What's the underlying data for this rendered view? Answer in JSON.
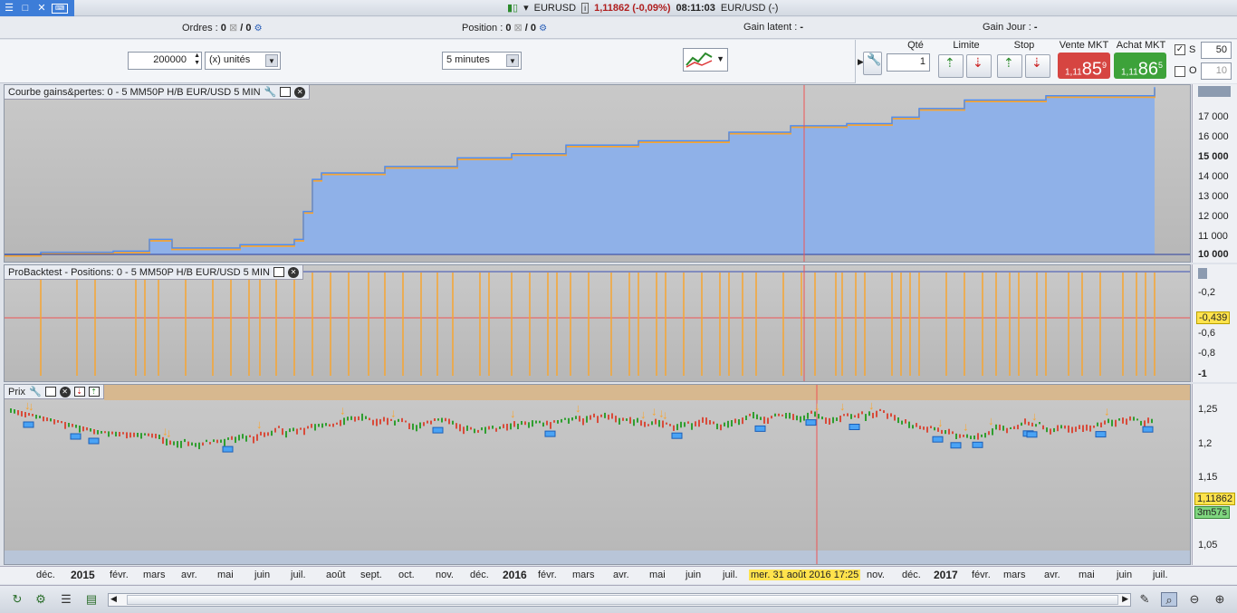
{
  "titlebar": {
    "symbol": "EURUSD",
    "price": "1,11862 (-0,09%)",
    "time": "08:11:03",
    "pair": "EUR/USD (-)"
  },
  "infobar": {
    "orders_label": "Ordres :",
    "orders_a": "0",
    "orders_b": "/ 0",
    "position_label": "Position :",
    "position_a": "0",
    "position_b": "/ 0",
    "gain_latent": "Gain latent :",
    "gain_latent_val": "-",
    "gain_jour": "Gain Jour :",
    "gain_jour_val": "-"
  },
  "toolbar": {
    "quantity": "200000",
    "units": "(x) unités",
    "timeframe": "5 minutes"
  },
  "orderpanel": {
    "qte_label": "Qté",
    "qte_value": "1",
    "limite_label": "Limite",
    "stop_label": "Stop",
    "sell_label": "Vente MKT",
    "sell_prefix": "1,11",
    "sell_big": "85",
    "sell_sup": "9",
    "buy_label": "Achat MKT",
    "buy_prefix": "1,11",
    "buy_big": "86",
    "buy_sup": "5",
    "s_label": "S",
    "s_value": "50",
    "o_label": "O",
    "o_value": "10"
  },
  "panels": {
    "equity_title": "Courbe gains&pertes: 0 - 5 MM50P H/B EUR/USD 5 MIN",
    "positions_title": "ProBacktest - Positions: 0 - 5 MM50P H/B EUR/USD 5 MIN",
    "price_title": "Prix"
  },
  "axes": {
    "equity": [
      "17 000",
      "16 000",
      "15 000",
      "14 000",
      "13 000",
      "12 000",
      "11 000",
      "10 000"
    ],
    "positions": [
      "-0,2",
      "-0,4",
      "-0,6",
      "-0,8",
      "-1"
    ],
    "positions_current": "-0,439",
    "price": [
      "1,25",
      "1,2",
      "1,15",
      "1,1",
      "1,05"
    ],
    "price_current": "1,11862",
    "countdown": "3m57s"
  },
  "dates": [
    "déc.",
    "2015",
    "févr.",
    "mars",
    "avr.",
    "mai",
    "juin",
    "juil.",
    "août",
    "sept.",
    "oct.",
    "nov.",
    "déc.",
    "2016",
    "févr.",
    "mars",
    "avr.",
    "mai",
    "juin",
    "juil.",
    "nov.",
    "déc.",
    "2017",
    "févr.",
    "mars",
    "avr.",
    "mai",
    "juin",
    "juil."
  ],
  "cursor_date": "mer. 31 août 2016 17:25",
  "colors": {
    "equity_line": "#4d8df5",
    "equity_fill": "#8fb1e8",
    "orange": "#f7a531",
    "blue_marker": "#4aa3f5"
  },
  "icons": [
    "wrench-icon",
    "window-icon",
    "close-icon",
    "gear-icon"
  ]
}
